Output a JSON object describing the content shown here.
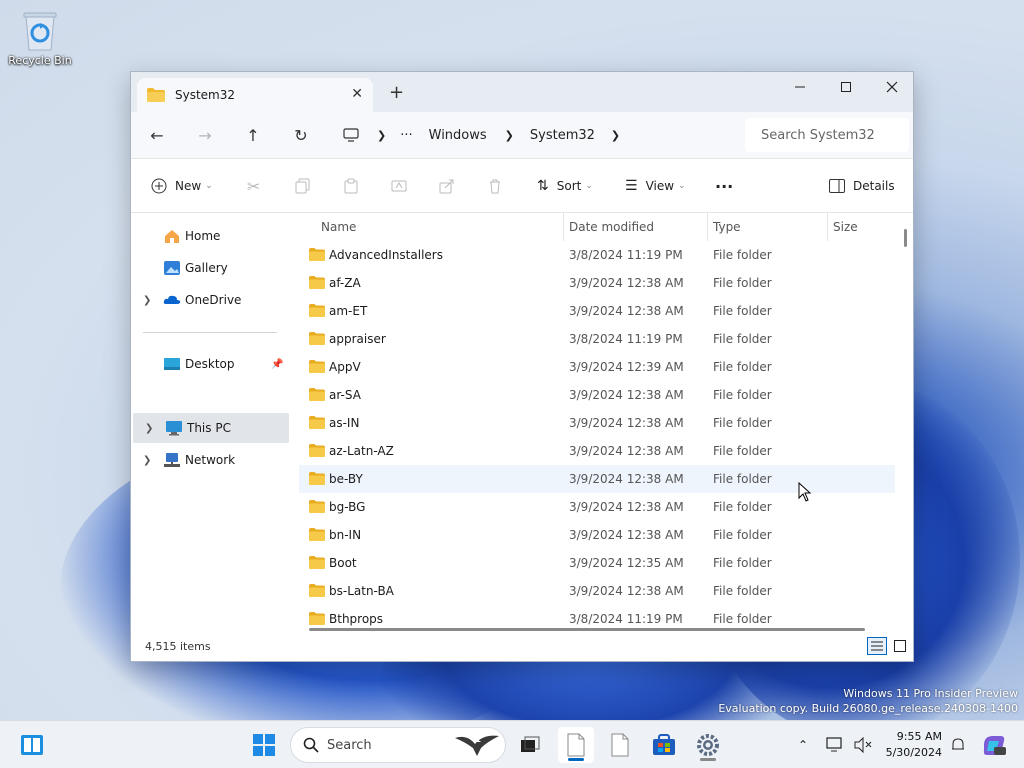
{
  "desktop": {
    "recycle_bin_label": "Recycle Bin",
    "watermark_line1": "Windows 11 Pro Insider Preview",
    "watermark_line2": "Evaluation copy. Build 26080.ge_release.240308-1400"
  },
  "window": {
    "tab_title": "System32",
    "search_placeholder": "Search System32",
    "breadcrumb": {
      "more": "···",
      "items": [
        "Windows",
        "System32"
      ]
    },
    "toolbar": {
      "new": "New",
      "sort": "Sort",
      "view": "View",
      "more": "···",
      "details": "Details"
    },
    "nav": {
      "home": "Home",
      "gallery": "Gallery",
      "onedrive": "OneDrive",
      "desktop": "Desktop",
      "thispc": "This PC",
      "network": "Network"
    },
    "columns": {
      "name": "Name",
      "date": "Date modified",
      "type": "Type",
      "size": "Size"
    },
    "rows": [
      {
        "name": "AdvancedInstallers",
        "date": "3/8/2024 11:19 PM",
        "type": "File folder"
      },
      {
        "name": "af-ZA",
        "date": "3/9/2024 12:38 AM",
        "type": "File folder"
      },
      {
        "name": "am-ET",
        "date": "3/9/2024 12:38 AM",
        "type": "File folder"
      },
      {
        "name": "appraiser",
        "date": "3/8/2024 11:19 PM",
        "type": "File folder"
      },
      {
        "name": "AppV",
        "date": "3/9/2024 12:39 AM",
        "type": "File folder"
      },
      {
        "name": "ar-SA",
        "date": "3/9/2024 12:38 AM",
        "type": "File folder"
      },
      {
        "name": "as-IN",
        "date": "3/9/2024 12:38 AM",
        "type": "File folder"
      },
      {
        "name": "az-Latn-AZ",
        "date": "3/9/2024 12:38 AM",
        "type": "File folder"
      },
      {
        "name": "be-BY",
        "date": "3/9/2024 12:38 AM",
        "type": "File folder"
      },
      {
        "name": "bg-BG",
        "date": "3/9/2024 12:38 AM",
        "type": "File folder"
      },
      {
        "name": "bn-IN",
        "date": "3/9/2024 12:38 AM",
        "type": "File folder"
      },
      {
        "name": "Boot",
        "date": "3/9/2024 12:35 AM",
        "type": "File folder"
      },
      {
        "name": "bs-Latn-BA",
        "date": "3/9/2024 12:38 AM",
        "type": "File folder"
      },
      {
        "name": "Bthprops",
        "date": "3/8/2024 11:19 PM",
        "type": "File folder"
      }
    ],
    "status": "4,515 items"
  },
  "taskbar": {
    "search_label": "Search",
    "time": "9:55 AM",
    "date": "5/30/2024"
  },
  "colors": {
    "accent": "#0067c0",
    "folder": "#f7c948",
    "folder_dark": "#e8ad20",
    "hover_row": "#eef5fd"
  }
}
